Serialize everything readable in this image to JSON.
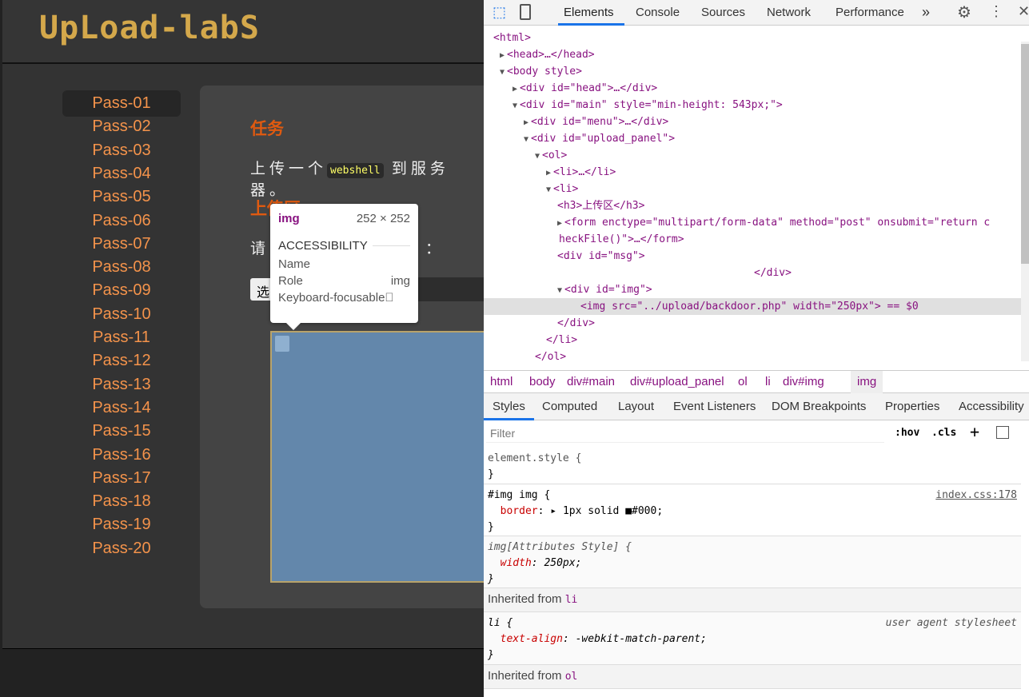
{
  "logo": "UpLoad-labS",
  "menu": [
    "Pass-01",
    "Pass-02",
    "Pass-03",
    "Pass-04",
    "Pass-05",
    "Pass-06",
    "Pass-07",
    "Pass-08",
    "Pass-09",
    "Pass-10",
    "Pass-11",
    "Pass-12",
    "Pass-13",
    "Pass-14",
    "Pass-15",
    "Pass-16",
    "Pass-17",
    "Pass-18",
    "Pass-19",
    "Pass-20"
  ],
  "panel": {
    "task_title": "任务",
    "task_pre": "上传一个",
    "task_code": "webshell",
    "task_post": "到服务器。",
    "upload_title": "上传区",
    "prompt_pre": "请",
    "prompt_post": "：",
    "file_button": "选"
  },
  "tooltip": {
    "tag": "img",
    "size": "252 × 252",
    "section": "ACCESSIBILITY",
    "name_label": "Name",
    "role_label": "Role",
    "role_value": "img",
    "focus_label": "Keyboard-focusable"
  },
  "devtools": {
    "tabs": [
      "Elements",
      "Console",
      "Sources",
      "Network",
      "Performance"
    ],
    "more": "»",
    "dom": [
      {
        "t": "<html>"
      },
      {
        "t": "<head>…</head>"
      },
      {
        "t": "<body style>"
      },
      {
        "t": "<div id=\"head\">…</div>"
      },
      {
        "t": "<div id=\"main\" style=\"min-height: 543px;\">"
      },
      {
        "t": "<div id=\"menu\">…</div>"
      },
      {
        "t": "<div id=\"upload_panel\">"
      },
      {
        "t": "<ol>"
      },
      {
        "t": "<li>…</li>"
      },
      {
        "t": "<li>"
      },
      {
        "t": "<h3>上传区</h3>"
      },
      {
        "t": "<form enctype=\"multipart/form-data\" method=\"post\" onsubmit=\"return c"
      },
      {
        "t": "heckFile()\">…</form>"
      },
      {
        "t": "<div id=\"msg\">"
      },
      {
        "t": "</div>"
      },
      {
        "t": "<div id=\"img\">"
      },
      {
        "t": "<img src=\"../upload/backdoor.php\" width=\"250px\"> == $0"
      },
      {
        "t": "</div>"
      },
      {
        "t": "</li>"
      },
      {
        "t": "</ol>"
      }
    ],
    "breadcrumbs": [
      "html",
      "body",
      "div#main",
      "div#upload_panel",
      "ol",
      "li",
      "div#img",
      "img"
    ],
    "subtabs": [
      "Styles",
      "Computed",
      "Layout",
      "Event Listeners",
      "DOM Breakpoints",
      "Properties",
      "Accessibility"
    ],
    "filter_placeholder": "Filter",
    "hov": ":hov",
    "cls": ".cls",
    "rules": {
      "r1_sel": "element.style {",
      "close": "}",
      "r2_sel": "#img img {",
      "r2_src": "index.css:178",
      "r2_prop": "border",
      "r2_val": "1px solid ■#000;",
      "r3_sel": "img[Attributes Style] {",
      "r3_prop": "width",
      "r3_val": "250px;",
      "inh_li": "Inherited from",
      "inh_li_tag": "li",
      "r4_sel": "li {",
      "r4_src": "user agent stylesheet",
      "r4_prop": "text-align",
      "r4_val": "-webkit-match-parent;",
      "inh_ol_tag": "ol"
    }
  },
  "colors": {
    "accent": "#e05a10",
    "menu": "#f4934b",
    "logo": "#d4a84b",
    "devtools_active": "#1a73e8"
  }
}
